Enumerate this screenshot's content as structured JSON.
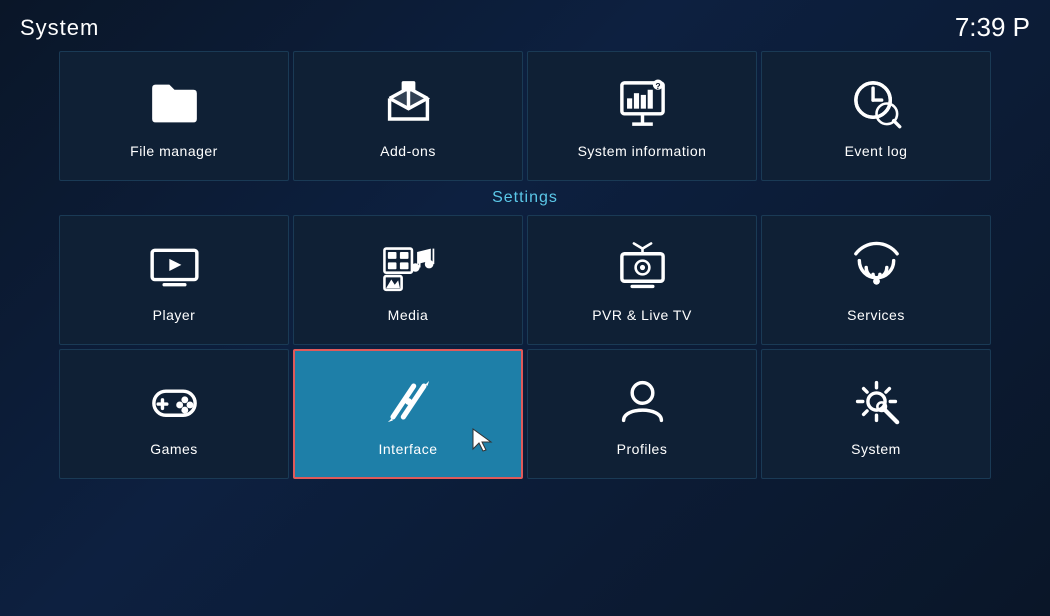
{
  "header": {
    "title": "System",
    "time": "7:39 P"
  },
  "section_label": "Settings",
  "top_row": [
    {
      "id": "file-manager",
      "label": "File manager",
      "icon": "folder"
    },
    {
      "id": "add-ons",
      "label": "Add-ons",
      "icon": "addons"
    },
    {
      "id": "system-information",
      "label": "System information",
      "icon": "sysinfo"
    },
    {
      "id": "event-log",
      "label": "Event log",
      "icon": "eventlog"
    }
  ],
  "settings_row1": [
    {
      "id": "player",
      "label": "Player",
      "icon": "player"
    },
    {
      "id": "media",
      "label": "Media",
      "icon": "media"
    },
    {
      "id": "pvr-live-tv",
      "label": "PVR & Live TV",
      "icon": "pvr"
    },
    {
      "id": "services",
      "label": "Services",
      "icon": "services"
    }
  ],
  "settings_row2": [
    {
      "id": "games",
      "label": "Games",
      "icon": "games"
    },
    {
      "id": "interface",
      "label": "Interface",
      "icon": "interface",
      "active": true
    },
    {
      "id": "profiles",
      "label": "Profiles",
      "icon": "profiles"
    },
    {
      "id": "system",
      "label": "System",
      "icon": "system"
    }
  ]
}
